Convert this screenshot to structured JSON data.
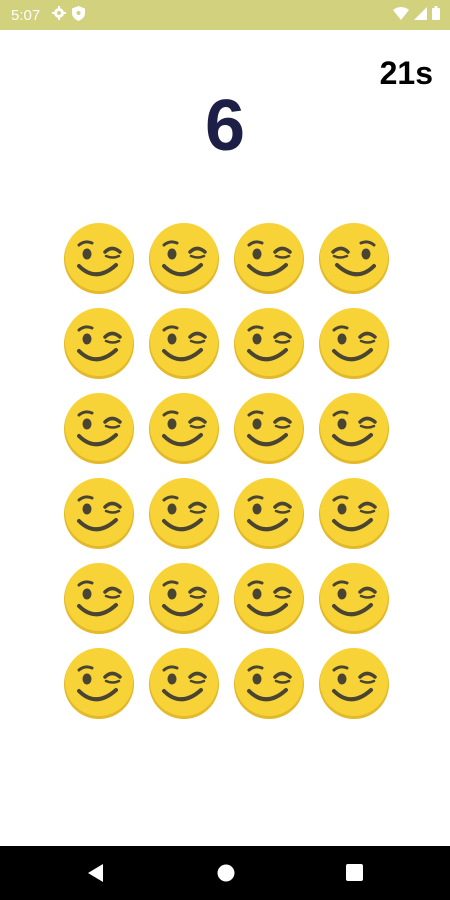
{
  "status_bar": {
    "time": "5:07",
    "background": "#d2d17d",
    "icons": [
      "gear-icon",
      "shield-icon",
      "wifi-icon",
      "cellular-icon",
      "battery-icon"
    ]
  },
  "game": {
    "timer": "21s",
    "score": "6",
    "score_color": "#1e1f47",
    "grid": {
      "rows": 6,
      "columns": 4,
      "cells": [
        "wink-face",
        "wink-face",
        "wink-face",
        "wink-face-mirrored",
        "wink-face",
        "wink-face",
        "wink-face",
        "wink-face",
        "wink-face",
        "wink-face",
        "wink-face",
        "wink-face",
        "wink-face",
        "wink-face",
        "wink-face",
        "wink-face",
        "wink-face",
        "wink-face",
        "wink-face",
        "wink-face",
        "wink-face",
        "wink-face",
        "wink-face",
        "wink-face"
      ],
      "emoji_color": "#f7d338"
    }
  },
  "nav_bar": {
    "buttons": [
      "back-icon",
      "home-icon",
      "recents-icon"
    ]
  }
}
